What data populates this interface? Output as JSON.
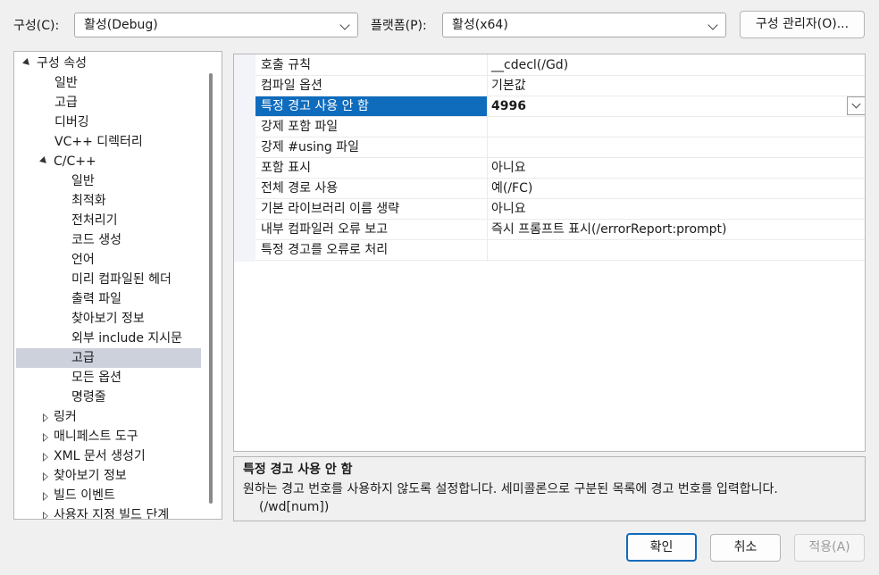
{
  "toolbar": {
    "config_label": "구성(C):",
    "config_value": "활성(Debug)",
    "platform_label": "플랫폼(P):",
    "platform_value": "활성(x64)",
    "config_manager_button": "구성 관리자(O)..."
  },
  "tree": {
    "root": "구성 속성",
    "items_level1": [
      "일반",
      "고급",
      "디버깅",
      "VC++ 디렉터리"
    ],
    "cpp": "C/C++",
    "cpp_children": [
      "일반",
      "최적화",
      "전처리기",
      "코드 생성",
      "언어",
      "미리 컴파일된 헤더",
      "출력 파일",
      "찾아보기 정보",
      "외부 include 지시문",
      "고급",
      "모든 옵션",
      "명령줄"
    ],
    "collapsed": [
      "링커",
      "매니페스트 도구",
      "XML 문서 생성기",
      "찾아보기 정보",
      "빌드 이벤트",
      "사용자 지정 빌드 단계"
    ],
    "selected": "고급"
  },
  "grid": {
    "rows": [
      {
        "name": "호출 규칙",
        "value": "__cdecl(/Gd)"
      },
      {
        "name": "컴파일 옵션",
        "value": "기본값"
      },
      {
        "name": "특정 경고 사용 안 함",
        "value": "4996"
      },
      {
        "name": "강제 포함 파일",
        "value": ""
      },
      {
        "name": "강제 #using 파일",
        "value": ""
      },
      {
        "name": "포함 표시",
        "value": "아니요"
      },
      {
        "name": "전체 경로 사용",
        "value": "예(/FC)"
      },
      {
        "name": "기본 라이브러리 이름 생략",
        "value": "아니요"
      },
      {
        "name": "내부 컴파일러 오류 보고",
        "value": "즉시 프롬프트 표시(/errorReport:prompt)"
      },
      {
        "name": "특정 경고를 오류로 처리",
        "value": ""
      }
    ]
  },
  "description": {
    "title": "특정 경고 사용 안 함",
    "body": "원하는 경고 번호를 사용하지 않도록 설정합니다. 세미콜론으로 구분된 목록에 경고 번호를 입력합니다.",
    "switch": "(/wd[num])"
  },
  "buttons": {
    "ok": "확인",
    "cancel": "취소",
    "apply": "적용(A)"
  },
  "colors": {
    "selected_row": "#0f6cbd",
    "tree_selection": "#cdd1dc"
  }
}
